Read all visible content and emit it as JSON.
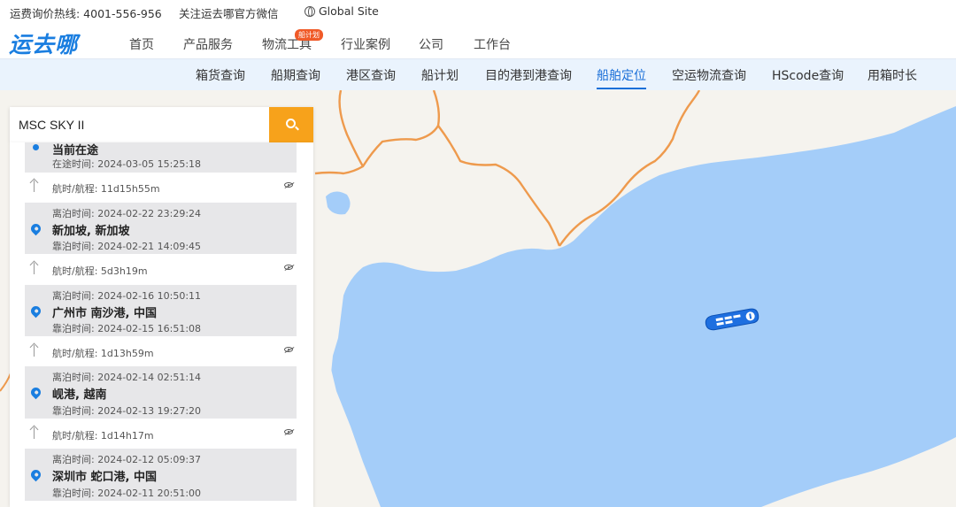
{
  "topbar": {
    "hotline": "运费询价热线: 4001-556-956",
    "wechat": "关注运去哪官方微信",
    "global": "Global Site"
  },
  "brand": {
    "logo": "运去哪"
  },
  "main_nav": {
    "items": [
      "首页",
      "产品服务",
      "物流工具",
      "行业案例",
      "公司",
      "工作台"
    ],
    "active": "物流工具",
    "badge": "船计划"
  },
  "sub_nav": {
    "items": [
      "箱货查询",
      "船期查询",
      "港区查询",
      "船计划",
      "目的港到港查询",
      "船舶定位",
      "空运物流查询",
      "HScode查询",
      "用箱时长"
    ],
    "active": "船舶定位"
  },
  "search": {
    "value": "MSC SKY II"
  },
  "voyage": {
    "current": {
      "status": "当前在途",
      "time_label": "在途时间: 2024-03-05 15:25:18"
    },
    "legs": [
      "航时/航程: 11d15h55m",
      "航时/航程: 5d3h19m",
      "航时/航程: 1d13h59m",
      "航时/航程: 1d14h17m"
    ],
    "ports": [
      {
        "depart": "离泊时间: 2024-02-22 23:29:24",
        "name": "新加坡, 新加坡",
        "arrive": "靠泊时间: 2024-02-21 14:09:45"
      },
      {
        "depart": "离泊时间: 2024-02-16 10:50:11",
        "name": "广州市 南沙港, 中国",
        "arrive": "靠泊时间: 2024-02-15 16:51:08"
      },
      {
        "depart": "离泊时间: 2024-02-14 02:51:14",
        "name": "岘港, 越南",
        "arrive": "靠泊时间: 2024-02-13 19:27:20"
      },
      {
        "depart": "离泊时间: 2024-02-12 05:09:37",
        "name": "深圳市 蛇口港, 中国",
        "arrive": "靠泊时间: 2024-02-11 20:51:00"
      }
    ]
  },
  "colors": {
    "brand": "#1a7ee0",
    "sea": "#a4cdf9",
    "land": "#f5f3ee",
    "border": "#ee9a4d",
    "search_button": "#f7a21b",
    "ship": "#1e6fe0"
  },
  "icons": [
    "globe-icon",
    "search-icon",
    "location-pin-icon",
    "up-arrow-icon",
    "eye-hidden-icon",
    "ship-icon"
  ]
}
